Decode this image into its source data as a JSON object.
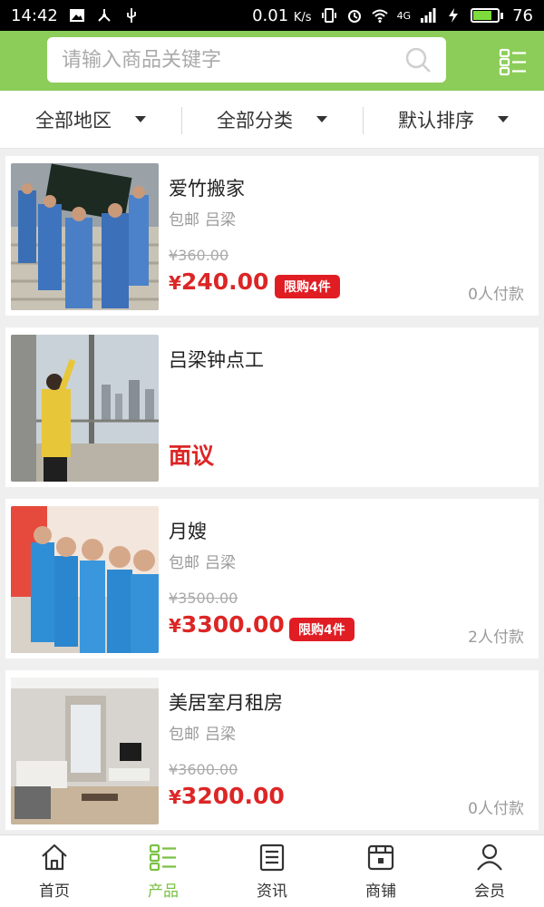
{
  "status_bar": {
    "time": "14:42",
    "net_speed": "0.01",
    "net_unit": "K/s",
    "network": "4G",
    "battery": "76",
    "battery_level": 0.76
  },
  "header": {
    "search_placeholder": "请输入商品关键字",
    "accent_color": "#8ccd5a"
  },
  "filters": [
    {
      "label": "全部地区"
    },
    {
      "label": "全部分类"
    },
    {
      "label": "默认排序"
    }
  ],
  "products": [
    {
      "title": "爱竹搬家",
      "shipping": "包邮",
      "location": "吕梁",
      "original_price": "¥360.00",
      "currency": "¥",
      "price": "240.00",
      "limit": "限购4件",
      "paid": "0人付款"
    },
    {
      "title": "吕梁钟点工",
      "negotiable": "面议"
    },
    {
      "title": "月嫂",
      "shipping": "包邮",
      "location": "吕梁",
      "original_price": "¥3500.00",
      "currency": "¥",
      "price": "3300.00",
      "limit": "限购4件",
      "paid": "2人付款"
    },
    {
      "title": "美居室月租房",
      "shipping": "包邮",
      "location": "吕梁",
      "original_price": "¥3600.00",
      "currency": "¥",
      "price": "3200.00",
      "paid": "0人付款"
    }
  ],
  "tabs": [
    {
      "label": "首页",
      "icon": "home-icon"
    },
    {
      "label": "产品",
      "icon": "list-icon",
      "active": true
    },
    {
      "label": "资讯",
      "icon": "news-icon"
    },
    {
      "label": "商铺",
      "icon": "shop-icon"
    },
    {
      "label": "会员",
      "icon": "user-icon"
    }
  ]
}
